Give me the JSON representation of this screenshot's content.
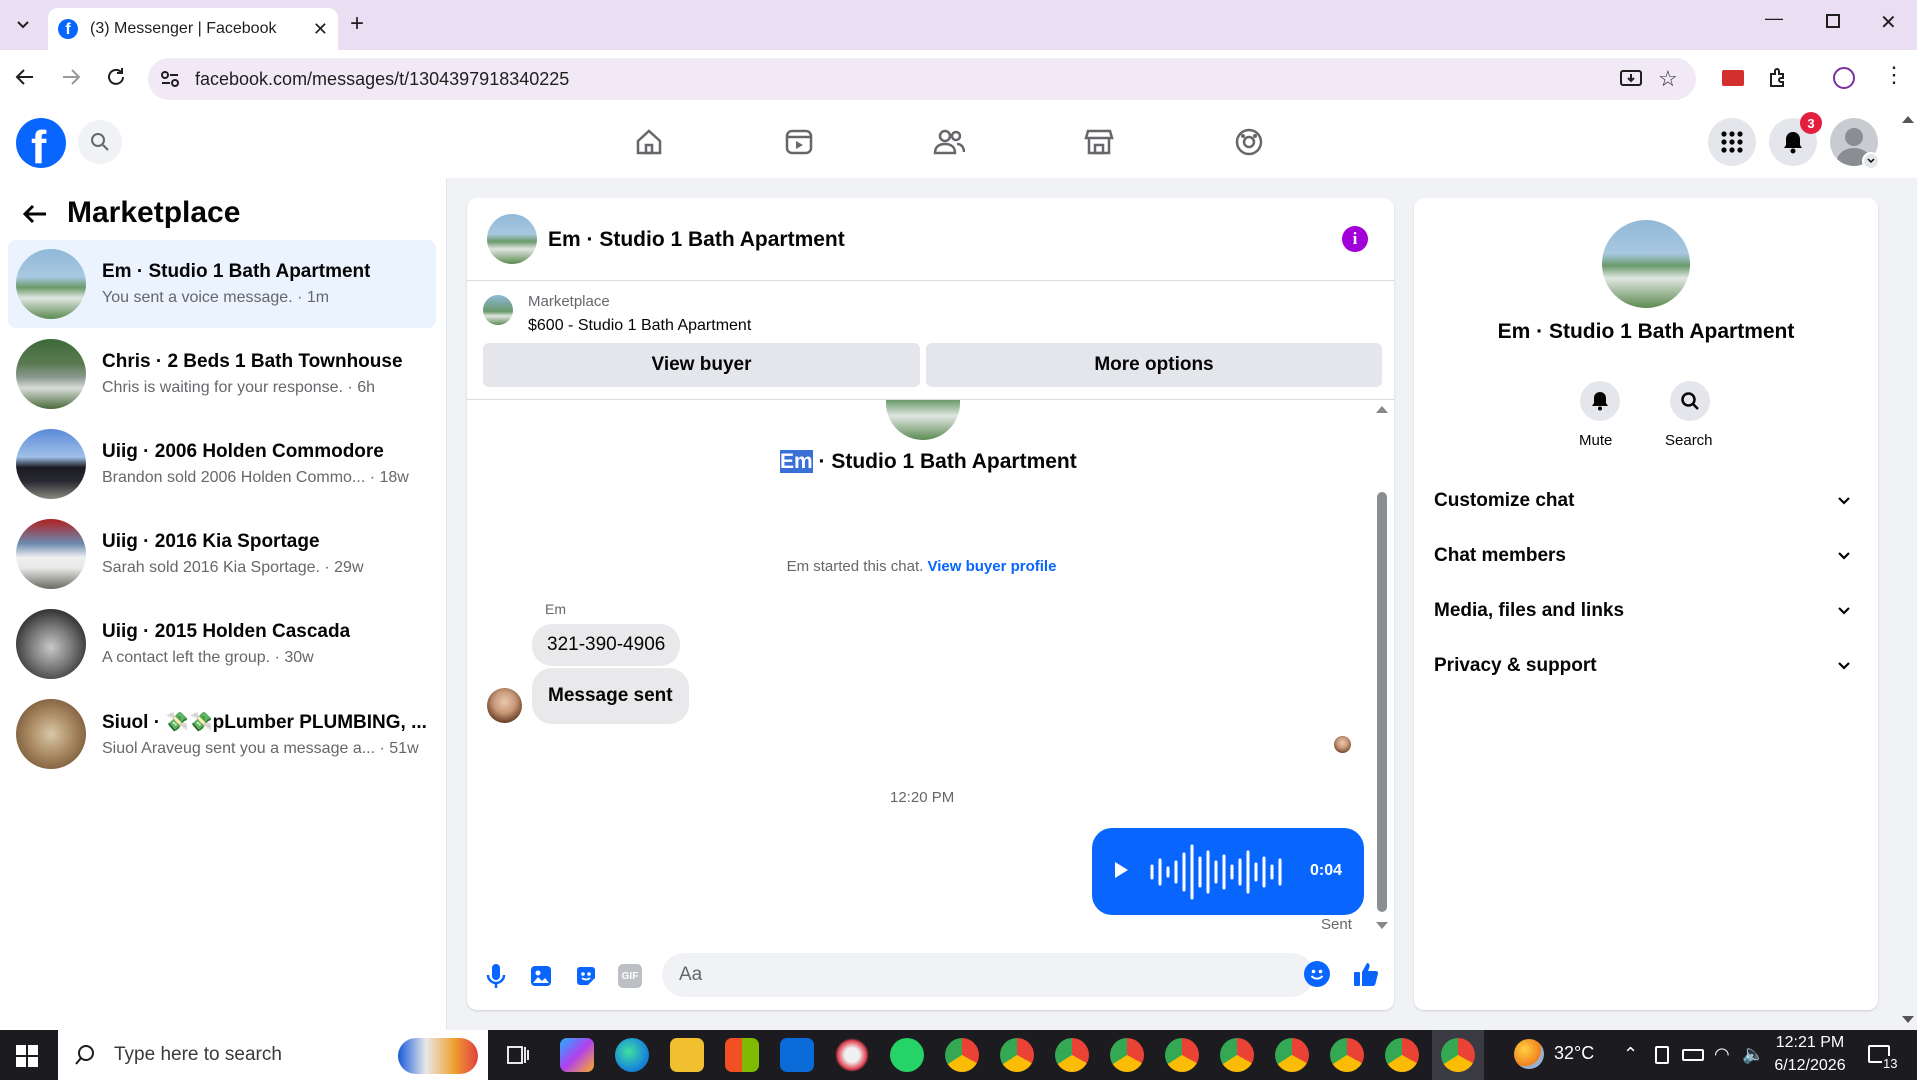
{
  "browser": {
    "tab_title": "(3) Messenger | Facebook",
    "url": "facebook.com/messages/t/1304397918340225"
  },
  "header": {
    "notifications_count": "3"
  },
  "sidebar": {
    "title": "Marketplace",
    "conversations": [
      {
        "name": "Em · Studio 1 Bath Apartment",
        "preview": "You sent a voice message. · 1m",
        "selected": true
      },
      {
        "name": "Chris · 2 Beds 1 Bath Townhouse",
        "preview": "Chris is waiting for your response. · 6h"
      },
      {
        "name": "Uiig · 2006 Holden Commodore",
        "preview": "Brandon sold 2006 Holden Commo... · 18w"
      },
      {
        "name": "Uiig · 2016 Kia Sportage",
        "preview": "Sarah sold 2016 Kia Sportage. · 29w"
      },
      {
        "name": "Uiig · 2015 Holden Cascada",
        "preview": "A contact left the group. · 30w"
      },
      {
        "name": "Siuol · 💸💸pLumber PLUMBING, ...",
        "preview": "Siuol Araveug sent you a message a... · 51w"
      }
    ]
  },
  "chat": {
    "title": "Em · Studio 1 Bath Apartment",
    "listing_label": "Marketplace",
    "listing_text": "$600 - Studio 1 Bath Apartment",
    "view_buyer": "View buyer",
    "more_options": "More options",
    "intro_name_highlight": "Em",
    "intro_name_rest": " · Studio 1 Bath Apartment",
    "started_text": "Em started this chat.",
    "view_buyer_profile": "View buyer profile",
    "sender_name": "Em",
    "messages": [
      "321-390-4906",
      "Message sent"
    ],
    "timestamp": "12:20 PM",
    "voice_duration": "0:04",
    "sent_status": "Sent",
    "composer_placeholder": "Aa"
  },
  "details": {
    "name": "Em · Studio 1 Bath Apartment",
    "mute": "Mute",
    "search": "Search",
    "sections": [
      "Customize chat",
      "Chat members",
      "Media, files and links",
      "Privacy & support"
    ]
  },
  "taskbar": {
    "search_placeholder": "Type here to search",
    "temperature": "32°C",
    "time": "12:21 PM",
    "date": "6/12/2026",
    "notif_count": "13"
  },
  "colors": {
    "accent": "#0a7cff",
    "messenger_blue": "#0866ff",
    "purple": "#a200d8"
  }
}
